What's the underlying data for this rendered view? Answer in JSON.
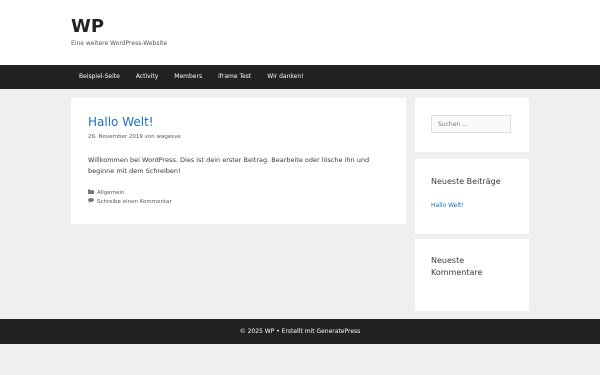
{
  "site": {
    "title": "WP",
    "description": "Eine weitere WordPress-Website"
  },
  "nav": {
    "items": [
      "Beispiel-Seite",
      "Activity",
      "Members",
      "iframe Test",
      "Wir danken!"
    ]
  },
  "post": {
    "title": "Hallo Welt!",
    "date": "26. November 2019",
    "by": "von",
    "author": "wagesve",
    "body": "Willkommen bei WordPress. Dies ist dein erster Beitrag. Bearbeite oder lösche ihn und beginne mit dem Schreiben!",
    "category": "Allgemein",
    "comment_link": "Schreibe einen Kommentar",
    "category_icon": "folder-icon",
    "comment_icon": "comment-icon"
  },
  "sidebar": {
    "search_placeholder": "Suchen …",
    "recent_posts_title": "Neueste Beiträge",
    "recent_post_item": "Hallo Welt!",
    "recent_comments_title": "Neueste Kommentare"
  },
  "footer": {
    "text": "© 2025 WP • Erstellt mit GeneratePress"
  },
  "colors": {
    "link": "#1e73be",
    "nav_bg": "#222222",
    "page_bg": "#efefef"
  }
}
